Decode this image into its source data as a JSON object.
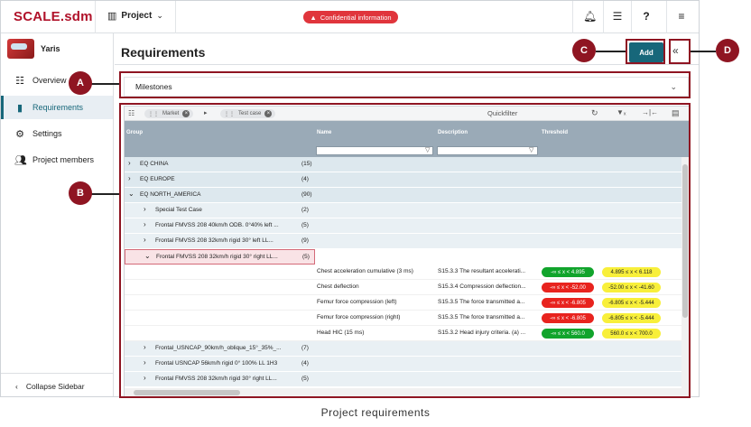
{
  "topbar": {
    "logo": "SCALE.sdm",
    "project_label": "Project",
    "confidential_label": "Confidential information",
    "icons": [
      "bell-icon",
      "checklist-icon",
      "help-icon",
      "menu-icon"
    ]
  },
  "sidebar": {
    "project_name": "Yaris",
    "items": [
      {
        "label": "Overview",
        "icon": "list-icon"
      },
      {
        "label": "Requirements",
        "icon": "bar-chart-icon",
        "active": true
      },
      {
        "label": "Settings",
        "icon": "gear-icon"
      },
      {
        "label": "Project members",
        "icon": "users-icon"
      }
    ],
    "collapse_label": "Collapse Sidebar"
  },
  "main": {
    "title": "Requirements",
    "add_label": "Add",
    "collapse_symbol": "«",
    "milestones_label": "Milestones"
  },
  "grid": {
    "toolbar": {
      "chips": [
        "Market",
        "Test case"
      ],
      "quickfilter_label": "Quickfilter"
    },
    "columns": [
      "Group",
      "Name",
      "Description",
      "Threshold"
    ],
    "rows": [
      {
        "kind": "grp",
        "chev": ">",
        "label": "EQ CHINA",
        "count": "(15)"
      },
      {
        "kind": "grp",
        "chev": ">",
        "label": "EQ EUROPE",
        "count": "(4)"
      },
      {
        "kind": "grp",
        "chev": "v",
        "label": "EQ NORTH_AMERICA",
        "count": "(90)"
      },
      {
        "kind": "grp2",
        "chev": ">",
        "label": "Special Test Case",
        "count": "(2)"
      },
      {
        "kind": "grp2",
        "chev": ">",
        "label": "Frontal FMVSS 208 40km/h ODB. 0°40% left ...",
        "count": "(5)"
      },
      {
        "kind": "grp2",
        "chev": ">",
        "label": "Frontal FMVSS 208 32km/h rigid 30° left LL...",
        "count": "(9)"
      },
      {
        "kind": "sel",
        "chev": "v",
        "label": "Frontal FMVSS 208 32km/h rigid 30° right LL...",
        "count": "(5)"
      },
      {
        "kind": "leaf",
        "name": "Chest acceleration cumulative (3 ms)",
        "desc": "S15.3.3 The resultant accelerati...",
        "t1": "-∞ ≤ x < 4.895",
        "t1c": "green",
        "t2": "4.895 ≤ x < 6.118",
        "t2c": "yellow"
      },
      {
        "kind": "leaf",
        "name": "Chest deflection",
        "desc": "S15.3.4 Compression deflection...",
        "t1": "-∞ ≤ x < -52.00",
        "t1c": "red",
        "t2": "-52.00 ≤ x < -41.60",
        "t2c": "yellow"
      },
      {
        "kind": "leaf",
        "name": "Femur force compression (left)",
        "desc": "S15.3.5 The force transmitted a...",
        "t1": "-∞ ≤ x < -6.805",
        "t1c": "red",
        "t2": "-6.805 ≤ x < -5.444",
        "t2c": "yellow"
      },
      {
        "kind": "leaf",
        "name": "Femur force compression (right)",
        "desc": "S15.3.5 The force transmitted a...",
        "t1": "-∞ ≤ x < -6.805",
        "t1c": "red",
        "t2": "-6.805 ≤ x < -5.444",
        "t2c": "yellow"
      },
      {
        "kind": "leaf",
        "name": "Head HIC (15 ms)",
        "desc": "S15.3.2 Head injury criteria. (a) ...",
        "t1": "-∞ ≤ x < 560.0",
        "t1c": "green",
        "t2": "560.0 ≤ x < 700.0",
        "t2c": "yellow"
      },
      {
        "kind": "grp2",
        "chev": ">",
        "label": "Frontal_USNCAP_90km/h_oblique_15°_35%_...",
        "count": "(7)"
      },
      {
        "kind": "grp2",
        "chev": ">",
        "label": "Frontal USNCAP 56km/h rigid 0° 100% LL 1H3",
        "count": "(4)"
      },
      {
        "kind": "grp2",
        "chev": ">",
        "label": "Frontal FMVSS 208 32km/h rigid 30° right LL...",
        "count": "(5)"
      }
    ]
  },
  "callouts": [
    "A",
    "B",
    "C",
    "D"
  ],
  "caption": "Project requirements",
  "colors": {
    "brand": "#b0122a",
    "accent": "#17677a",
    "callout": "#8f1522"
  }
}
